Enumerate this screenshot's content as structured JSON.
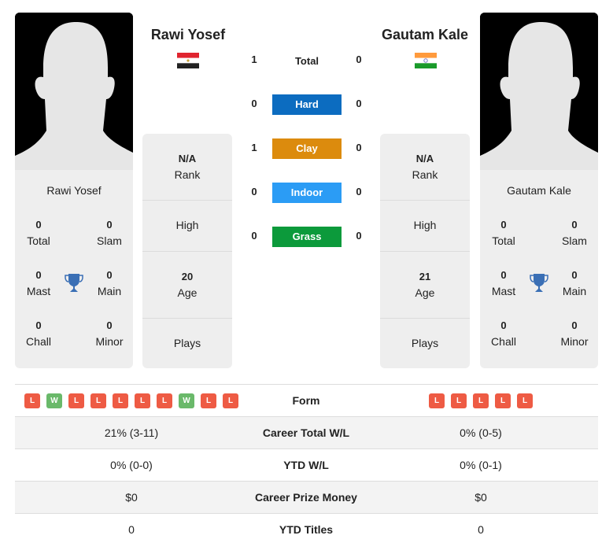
{
  "colors": {
    "hard": "#0c6cc0",
    "clay": "#dc8b0d",
    "indoor": "#2b9cf5",
    "grass": "#0c9a3b",
    "loss": "#ee5b44",
    "win": "#6ab96a",
    "trophy": "#3a6fb5"
  },
  "player1": {
    "name": "Rawi Yosef",
    "flag": "egypt-flag-icon",
    "card_name": "Rawi Yosef",
    "titles": {
      "total": {
        "value": "0",
        "label": "Total"
      },
      "slam": {
        "value": "0",
        "label": "Slam"
      },
      "mast": {
        "value": "0",
        "label": "Mast"
      },
      "main": {
        "value": "0",
        "label": "Main"
      },
      "chall": {
        "value": "0",
        "label": "Chall"
      },
      "minor": {
        "value": "0",
        "label": "Minor"
      }
    },
    "info": {
      "rank": {
        "value": "N/A",
        "label": "Rank"
      },
      "high": {
        "label": "High"
      },
      "age": {
        "value": "20",
        "label": "Age"
      },
      "plays": {
        "label": "Plays"
      }
    },
    "form": [
      "L",
      "W",
      "L",
      "L",
      "L",
      "L",
      "L",
      "W",
      "L",
      "L"
    ]
  },
  "player2": {
    "name": "Gautam Kale",
    "flag": "india-flag-icon",
    "card_name": "Gautam Kale",
    "titles": {
      "total": {
        "value": "0",
        "label": "Total"
      },
      "slam": {
        "value": "0",
        "label": "Slam"
      },
      "mast": {
        "value": "0",
        "label": "Mast"
      },
      "main": {
        "value": "0",
        "label": "Main"
      },
      "chall": {
        "value": "0",
        "label": "Chall"
      },
      "minor": {
        "value": "0",
        "label": "Minor"
      }
    },
    "info": {
      "rank": {
        "value": "N/A",
        "label": "Rank"
      },
      "high": {
        "label": "High"
      },
      "age": {
        "value": "21",
        "label": "Age"
      },
      "plays": {
        "label": "Plays"
      }
    },
    "form": [
      "L",
      "L",
      "L",
      "L",
      "L"
    ]
  },
  "h2h": {
    "total": {
      "label": "Total",
      "p1": "1",
      "p2": "0"
    },
    "surfaces": [
      {
        "label": "Hard",
        "p1": "0",
        "p2": "0"
      },
      {
        "label": "Clay",
        "p1": "1",
        "p2": "0"
      },
      {
        "label": "Indoor",
        "p1": "0",
        "p2": "0"
      },
      {
        "label": "Grass",
        "p1": "0",
        "p2": "0"
      }
    ]
  },
  "stats": {
    "form_label": "Form",
    "rows": [
      {
        "label": "Career Total W/L",
        "p1": "21% (3-11)",
        "p2": "0% (0-5)"
      },
      {
        "label": "YTD W/L",
        "p1": "0% (0-0)",
        "p2": "0% (0-1)"
      },
      {
        "label": "Career Prize Money",
        "p1": "$0",
        "p2": "$0"
      },
      {
        "label": "YTD Titles",
        "p1": "0",
        "p2": "0"
      }
    ]
  }
}
